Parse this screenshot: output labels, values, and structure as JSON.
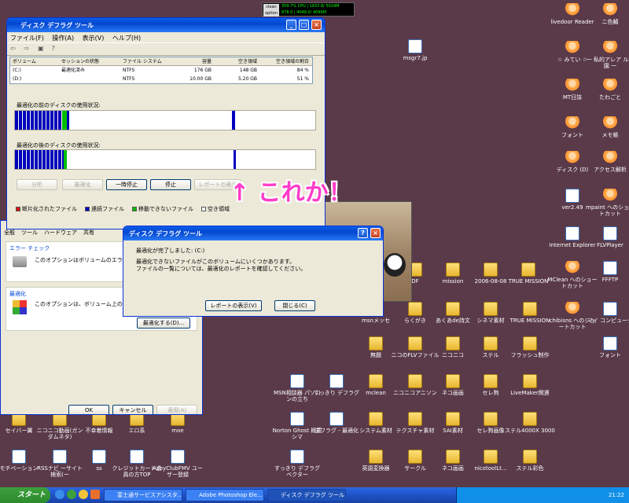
{
  "perf_meter": {
    "btn1": "clean",
    "btn2": "option",
    "row1": "359.7% CPU | 1632.8/ 5024M",
    "row2": "878.0 | 4048.0/ 4096M"
  },
  "defrag": {
    "title": "ディスク デフラグ ツール",
    "menu": [
      "ファイル(F)",
      "操作(A)",
      "表示(V)",
      "ヘルプ(H)"
    ],
    "columns": [
      "ボリューム",
      "セッションの状態",
      "ファイル システム",
      "容量",
      "空き領域",
      "空き領域の割合"
    ],
    "volumes": [
      {
        "name": "(C:)",
        "status": "最適化済み",
        "fs": "NTFS",
        "capacity": "176 GB",
        "free": "148 GB",
        "pct": "84 %"
      },
      {
        "name": "(D:)",
        "status": "",
        "fs": "NTFS",
        "capacity": "10.00 GB",
        "free": "5.20 GB",
        "pct": "51 %"
      }
    ],
    "before_label": "最適化の前のディスクの使用状況:",
    "after_label": "最適化の後のディスクの使用状況:",
    "buttons": {
      "analyze": "分析",
      "defrag": "最適化",
      "pause": "一時停止",
      "stop": "停止",
      "report": "レポートの表示"
    },
    "legend": [
      "断片化されたファイル",
      "連続ファイル",
      "移動できないファイル",
      "空き領域"
    ],
    "legend_colors": [
      "#e01010",
      "#0000c0",
      "#00c000",
      "#ffffff"
    ]
  },
  "annotation": "↑ これか！",
  "dialog": {
    "title": "ディスク デフラグ ツール",
    "line1": "最適化が完了しました: (C:)",
    "line2": "最適化できないファイルがこのボリュームにいくつかあります。",
    "line3": "ファイルの一覧については、最適化のレポートを確認してください。",
    "report_button": "レポートの表示(V)",
    "close_button": "閉じる(C)"
  },
  "props": {
    "tabs": [
      "全般",
      "ツール",
      "ハードウェア",
      "共有"
    ],
    "error_title": "エラー チェック",
    "error_text": "このオプションはボリュームのエラーをチェック",
    "defrag_title": "最適化",
    "defrag_text": "このオプションは、ボリューム上の断片化",
    "defrag_button": "最適化する(D)...",
    "ok": "OK",
    "cancel": "キャンセル",
    "apply": "適用(A)"
  },
  "desktop_icons": [
    {
      "label": "msgr7.jp",
      "type": "doc"
    },
    {
      "label": "livedoor Reader",
      "type": "char"
    },
    {
      "label": "ニ色鯖",
      "type": "char"
    },
    {
      "label": "☆ みてい ☆",
      "type": "char"
    },
    {
      "label": "一 私的アレア ル学園 一",
      "type": "char"
    },
    {
      "label": "MT日誌",
      "type": "char"
    },
    {
      "label": "たわごと",
      "type": "char"
    },
    {
      "label": "フォント",
      "type": "char"
    },
    {
      "label": "メモ帳",
      "type": "char"
    },
    {
      "label": "ディスク (D)",
      "type": "char"
    },
    {
      "label": "アクセス解析",
      "type": "char"
    },
    {
      "label": "ver2.49",
      "type": "doc"
    },
    {
      "label": "mpaint へのショートカット",
      "type": "char"
    },
    {
      "label": "Internet Explorer",
      "type": "doc"
    },
    {
      "label": "FLVPlayer",
      "type": "doc"
    },
    {
      "label": "MClean へのショートカット",
      "type": "char"
    },
    {
      "label": "FFFTP",
      "type": "doc"
    },
    {
      "label": "chibisns へのショートカット",
      "type": "char"
    },
    {
      "label": "マイ コンピュータ",
      "type": "doc"
    },
    {
      "label": "フォント",
      "type": "doc"
    },
    {
      "label": "DF",
      "type": "folder"
    },
    {
      "label": "mission",
      "type": "folder"
    },
    {
      "label": "2006-08-08",
      "type": "folder"
    },
    {
      "label": "TRUE MISSION",
      "type": "folder"
    },
    {
      "label": "msnメッセ",
      "type": "folder"
    },
    {
      "label": "らくがき",
      "type": "folder"
    },
    {
      "label": "あくあde詩文",
      "type": "folder"
    },
    {
      "label": "シネマ素材",
      "type": "folder"
    },
    {
      "label": "TRUE MISSION",
      "type": "folder"
    },
    {
      "label": "無題",
      "type": "folder"
    },
    {
      "label": "ニコのFLVファイル",
      "type": "folder"
    },
    {
      "label": "ニコニコ",
      "type": "folder"
    },
    {
      "label": "ステル",
      "type": "folder"
    },
    {
      "label": "フラッシュ制作",
      "type": "folder"
    },
    {
      "label": "MSN相談器 パソコンの立ち",
      "type": "doc"
    },
    {
      "label": "すっきり デフラグ",
      "type": "doc"
    },
    {
      "label": "mclean",
      "type": "folder"
    },
    {
      "label": "ニコニコアニソン",
      "type": "folder"
    },
    {
      "label": "ネコ画画",
      "type": "folder"
    },
    {
      "label": "セレ狗",
      "type": "folder"
    },
    {
      "label": "LiveMaker関連",
      "type": "folder"
    },
    {
      "label": "セイバー翼",
      "type": "folder"
    },
    {
      "label": "ニコニコ動画(ガンダムネタ)",
      "type": "folder"
    },
    {
      "label": "不幸着情報",
      "type": "folder"
    },
    {
      "label": "エロ系",
      "type": "folder"
    },
    {
      "label": "moe",
      "type": "folder"
    },
    {
      "label": "Norton Ghost 概要 シマ",
      "type": "doc"
    },
    {
      "label": "デフラグ - 最適化",
      "type": "doc"
    },
    {
      "label": "システム素材",
      "type": "folder"
    },
    {
      "label": "テクスチャ素材",
      "type": "folder"
    },
    {
      "label": "SAI素材",
      "type": "folder"
    },
    {
      "label": "セレ狗画像",
      "type": "folder"
    },
    {
      "label": "ステル4000X 3000",
      "type": "folder"
    },
    {
      "label": "モチベーション",
      "type": "doc"
    },
    {
      "label": "RSSナビ ーサイト検索(ー",
      "type": "doc"
    },
    {
      "label": "ss",
      "type": "doc"
    },
    {
      "label": "クレジットカード会員の方TOP",
      "type": "doc"
    },
    {
      "label": "AzbyClubFMV ユーザー登録",
      "type": "doc"
    },
    {
      "label": "すっきり デフラグ ベクター",
      "type": "doc"
    },
    {
      "label": "英語変換器",
      "type": "folder"
    },
    {
      "label": "サークル",
      "type": "folder"
    },
    {
      "label": "ネコ画画",
      "type": "folder"
    },
    {
      "label": "nicotoolLt...",
      "type": "folder"
    },
    {
      "label": "ステル彩色",
      "type": "folder"
    }
  ],
  "taskbar": {
    "start": "スタート",
    "tasks": [
      "富士通サービスアシスタ...",
      "Adobe Photoshop Ele...",
      "ディスク デフラグ ツール"
    ],
    "time": "21:22"
  }
}
